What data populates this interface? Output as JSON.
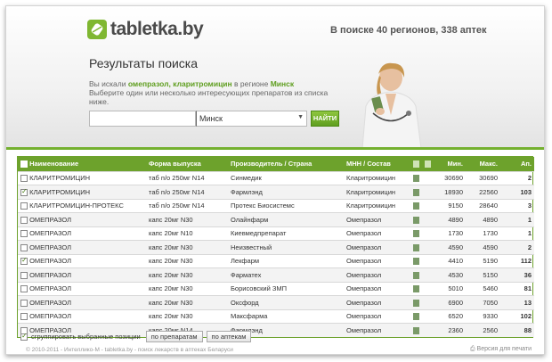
{
  "header": {
    "logo_text": "tabletka.by",
    "region_info": "В поиске 40 регионов, 338 аптек"
  },
  "search": {
    "title": "Результаты поиска",
    "desc_prefix": "Вы искали ",
    "query": "омепразол, кларитромицин",
    "desc_mid": " в регионе ",
    "region_name": "Минск",
    "desc_line2": "Выберите один или несколько интересующих препаратов из списка ниже.",
    "region_select_value": "Минск",
    "find_button": "НАЙТИ"
  },
  "table": {
    "headers": {
      "name": "Наименование",
      "form": "Форма выпуска",
      "maker": "Производитель / Страна",
      "inn": "МНН / Состав",
      "min": "Мин.",
      "max": "Макс.",
      "count": "Ап."
    },
    "rows": [
      {
        "checked": false,
        "name": "КЛАРИТРОМИЦИН",
        "form": "таб п/о 250мг N14",
        "maker": "Синмедик",
        "inn": "Кларитромицин",
        "min": "30690",
        "max": "30690",
        "count": "2"
      },
      {
        "checked": true,
        "name": "КЛАРИТРОМИЦИН",
        "form": "таб п/о 250мг N14",
        "maker": "Фармлэнд",
        "inn": "Кларитромицин",
        "min": "18930",
        "max": "22560",
        "count": "103"
      },
      {
        "checked": false,
        "name": "КЛАРИТРОМИЦИН-ПРОТЕКС",
        "form": "таб п/о 250мг N14",
        "maker": "Протекс Биосистемс",
        "inn": "Кларитромицин",
        "min": "9150",
        "max": "28640",
        "count": "3"
      },
      {
        "checked": false,
        "name": "ОМЕПРАЗОЛ",
        "form": "капс 20мг N30",
        "maker": "Олайнфарм",
        "inn": "Омепразол",
        "min": "4890",
        "max": "4890",
        "count": "1"
      },
      {
        "checked": false,
        "name": "ОМЕПРАЗОЛ",
        "form": "капс 20мг N10",
        "maker": "Киевмедпрепарат",
        "inn": "Омепразол",
        "min": "1730",
        "max": "1730",
        "count": "1"
      },
      {
        "checked": false,
        "name": "ОМЕПРАЗОЛ",
        "form": "капс 20мг N30",
        "maker": "Неизвестный",
        "inn": "Омепразол",
        "min": "4590",
        "max": "4590",
        "count": "2"
      },
      {
        "checked": true,
        "name": "ОМЕПРАЗОЛ",
        "form": "капс 20мг N30",
        "maker": "Лекфарм",
        "inn": "Омепразол",
        "min": "4410",
        "max": "5190",
        "count": "112"
      },
      {
        "checked": false,
        "name": "ОМЕПРАЗОЛ",
        "form": "капс 20мг N30",
        "maker": "Фарматех",
        "inn": "Омепразол",
        "min": "4530",
        "max": "5150",
        "count": "36"
      },
      {
        "checked": false,
        "name": "ОМЕПРАЗОЛ",
        "form": "капс 20мг N30",
        "maker": "Борисовский ЗМП",
        "inn": "Омепразол",
        "min": "5010",
        "max": "5460",
        "count": "81"
      },
      {
        "checked": false,
        "name": "ОМЕПРАЗОЛ",
        "form": "капс 20мг N30",
        "maker": "Оксфорд",
        "inn": "Омепразол",
        "min": "6900",
        "max": "7050",
        "count": "13"
      },
      {
        "checked": false,
        "name": "ОМЕПРАЗОЛ",
        "form": "капс 20мг N30",
        "maker": "Максфарма",
        "inn": "Омепразол",
        "min": "6520",
        "max": "9330",
        "count": "102"
      },
      {
        "checked": false,
        "name": "ОМЕПРАЗОЛ",
        "form": "капс 20мг N14",
        "maker": "Фармлэнд",
        "inn": "Омепразол",
        "min": "2360",
        "max": "2560",
        "count": "88"
      }
    ]
  },
  "footer": {
    "group_label": "сгруппировать выбранные позиции",
    "by_drugs": "по препаратам",
    "by_pharmacies": "по аптекам",
    "copyright": "© 2010-2011 - Интеллико-М - tabletka.by - поиск лекарств в аптеках Беларуси",
    "print_link": "Версия для печати"
  },
  "colors": {
    "brand_green": "#6da22c",
    "text_green": "#5f9e1f"
  }
}
